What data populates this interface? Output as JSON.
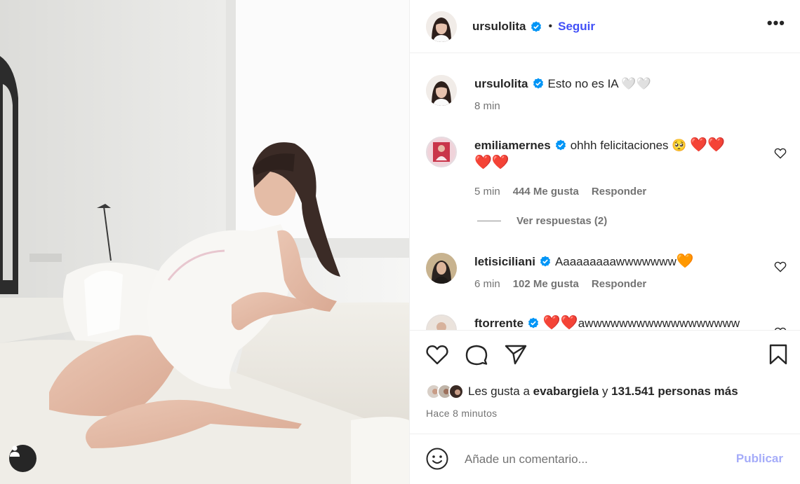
{
  "header": {
    "username": "ursulolita",
    "separator": "•",
    "follow_label": "Seguir",
    "more_label": "•••"
  },
  "caption": {
    "username": "ursulolita",
    "text": "Esto no es IA 🤍🤍",
    "time": "8 min"
  },
  "comments": [
    {
      "username": "emiliamernes",
      "text": "ohhh felicitaciones 🥺",
      "hearts": "❤️❤️",
      "hearts_line2": "❤️❤️",
      "time": "5 min",
      "likes": "444 Me gusta",
      "reply_label": "Responder",
      "view_replies": "Ver respuestas (2)"
    },
    {
      "username": "letisiciliani",
      "text": "Aaaaaaaaawwwwwww",
      "hearts": "🧡",
      "time": "6 min",
      "likes": "102 Me gusta",
      "reply_label": "Responder"
    },
    {
      "username": "ftorrente",
      "hearts": "❤️❤️",
      "text": "awwwwwwwwwwwwwwwwww"
    }
  ],
  "likes": {
    "prefix": "Les gusta a",
    "user": "evabargiela",
    "conj": "y",
    "count": "131.541 personas más"
  },
  "posted_ago": "Hace 8 minutos",
  "composer": {
    "placeholder": "Añade un comentario...",
    "publish_label": "Publicar"
  },
  "icons": {
    "like": "heart-outline-icon",
    "comment": "comment-bubble-icon",
    "share": "paper-plane-icon",
    "save": "bookmark-icon",
    "emoji": "smiley-icon",
    "tag": "user-tag-icon",
    "verified": "verified-badge-icon"
  },
  "colors": {
    "link_blue": "#4150f7",
    "verified_blue": "#0095f6",
    "publish_disabled": "#a5acf9",
    "secondary_text": "#737373"
  }
}
